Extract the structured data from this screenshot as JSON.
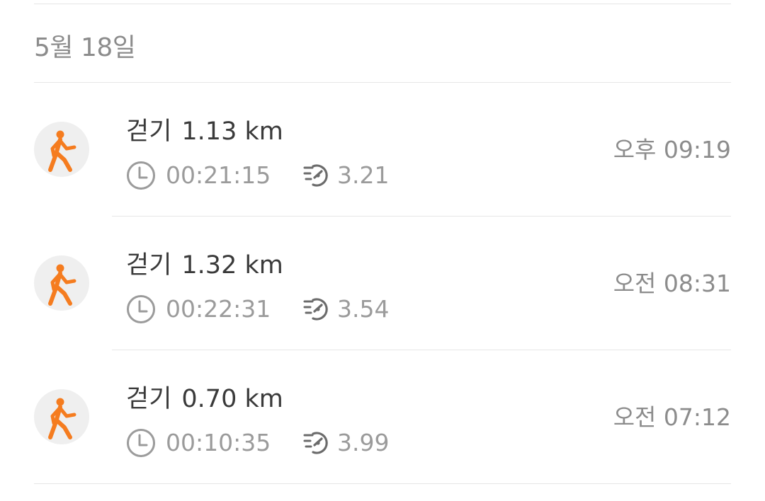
{
  "date_header": "5월 18일",
  "colors": {
    "accent": "#f57c1f",
    "icon_bg": "#efefef",
    "secondary_text": "#9b9b9b"
  },
  "activities": [
    {
      "icon": "walking-icon",
      "type": "걷기",
      "distance": "1.13 km",
      "duration": "00:21:15",
      "pace": "3.21",
      "time": "오후 09:19"
    },
    {
      "icon": "walking-icon",
      "type": "걷기",
      "distance": "1.32 km",
      "duration": "00:22:31",
      "pace": "3.54",
      "time": "오전 08:31"
    },
    {
      "icon": "walking-icon",
      "type": "걷기",
      "distance": "0.70 km",
      "duration": "00:10:35",
      "pace": "3.99",
      "time": "오전 07:12"
    }
  ]
}
